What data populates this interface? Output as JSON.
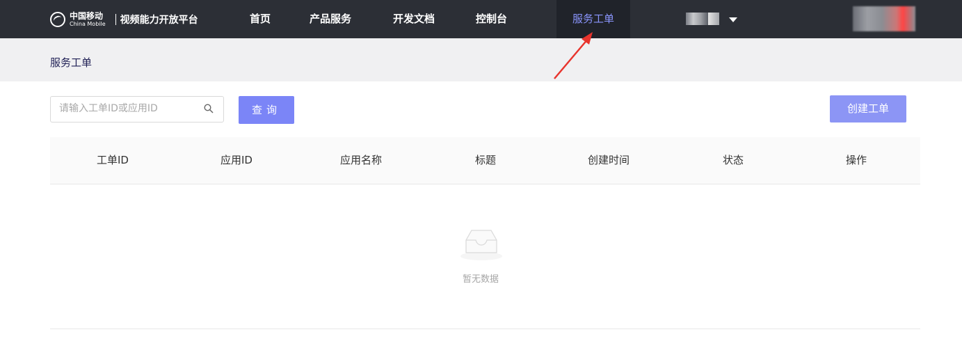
{
  "header": {
    "logo_cn": "中国移动",
    "logo_en": "China Mobile",
    "platform_name": "视频能力开放平台",
    "nav": [
      {
        "label": "首页"
      },
      {
        "label": "产品服务"
      },
      {
        "label": "开发文档"
      },
      {
        "label": "控制台"
      },
      {
        "label": "服务工单",
        "active": true
      }
    ]
  },
  "breadcrumb": {
    "title": "服务工单"
  },
  "search": {
    "placeholder": "请输入工单ID或应用ID",
    "value": ""
  },
  "buttons": {
    "query": "查询",
    "create": "创建工单"
  },
  "table": {
    "columns": [
      "工单ID",
      "应用ID",
      "应用名称",
      "标题",
      "创建时间",
      "状态",
      "操作"
    ],
    "rows": [],
    "empty_text": "暂无数据"
  },
  "colors": {
    "topbar": "#2c2f36",
    "active_nav_text": "#8b96ff",
    "primary_button": "#7b85f7",
    "annotation_arrow": "#e8342d"
  },
  "icons": [
    "china-mobile-logo-icon",
    "search-icon",
    "chevron-down-icon",
    "empty-inbox-icon",
    "red-arrow-annotation"
  ]
}
